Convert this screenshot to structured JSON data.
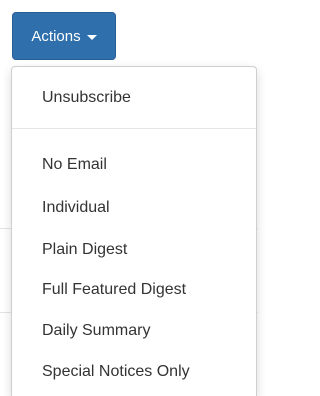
{
  "toolbar": {
    "actions_label": "Actions"
  },
  "menu": {
    "unsubscribe_label": "Unsubscribe",
    "items": [
      "No Email",
      "Individual",
      "Plain Digest",
      "Full Featured Digest",
      "Daily Summary",
      "Special Notices Only"
    ]
  },
  "colors": {
    "button_bg": "#2f6fac",
    "button_text": "#ffffff",
    "menu_text": "#333333"
  }
}
